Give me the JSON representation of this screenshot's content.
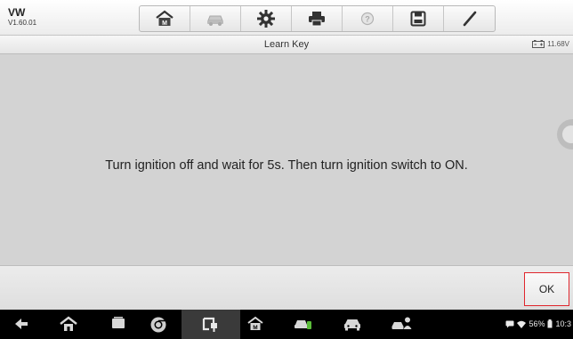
{
  "vehicle": {
    "make": "VW",
    "version": "V1.60.01"
  },
  "toolbar": {
    "buttons": [
      {
        "icon": "home-icon"
      },
      {
        "icon": "vehicle-swap-icon",
        "disabled": true
      },
      {
        "icon": "gear-icon"
      },
      {
        "icon": "printer-icon"
      },
      {
        "icon": "help-icon",
        "disabled": true
      },
      {
        "icon": "save-icon"
      },
      {
        "icon": "pen-icon"
      }
    ]
  },
  "header": {
    "title": "Learn Key",
    "battery_voltage": "11.68V"
  },
  "main": {
    "message": "Turn ignition off and wait for 5s. Then turn ignition switch to ON."
  },
  "actions": {
    "ok_label": "OK",
    "ok_border_color": "#e0262d"
  },
  "navbar": {
    "icons": [
      "back-icon",
      "home-icon",
      "recent-apps-icon",
      "chrome-icon",
      "vci-icon",
      "maxisys-home-icon",
      "car-service-icon",
      "car-icon",
      "remote-expert-icon"
    ],
    "battery_percent": "56%",
    "clock": "10:3"
  }
}
